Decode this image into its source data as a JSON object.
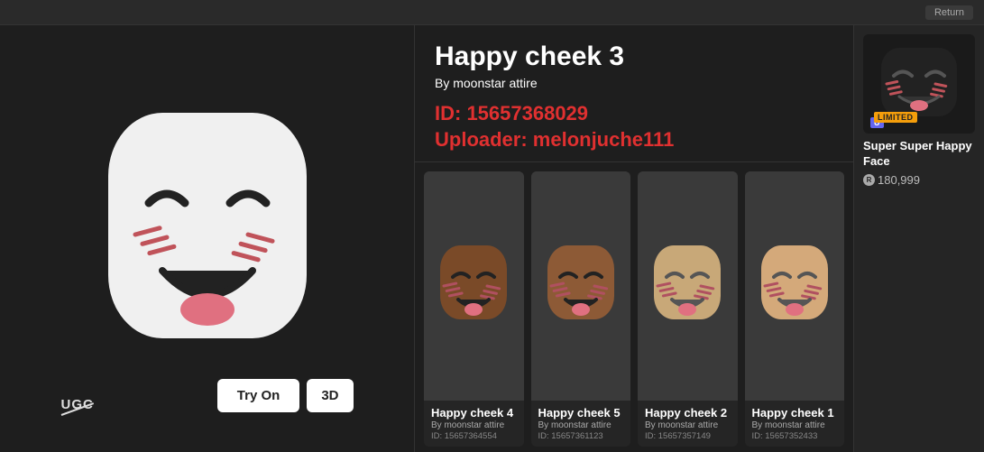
{
  "topbar": {
    "return_label": "Return"
  },
  "item": {
    "title": "Happy cheek 3",
    "creator_prefix": "By",
    "creator": "moonstar attire",
    "id_label": "ID: 15657368029",
    "uploader_label": "Uploader: melonjuche111"
  },
  "buttons": {
    "try_on": "Try On",
    "three_d": "3D"
  },
  "ugc": {
    "label": "UGC"
  },
  "featured": {
    "name": "Super Super Happy Face",
    "limited_label": "LIMITED",
    "limited_u_label": "U",
    "price": "180,999"
  },
  "related_items": [
    {
      "name": "Happy cheek 4",
      "creator": "By moonstar attire",
      "id": "ID: 15657364554",
      "skin": "dark-brown"
    },
    {
      "name": "Happy cheek 5",
      "creator": "By moonstar attire",
      "id": "ID: 15657361123",
      "skin": "brown"
    },
    {
      "name": "Happy cheek 2",
      "creator": "By moonstar attire",
      "id": "ID: 15657357149",
      "skin": "tan"
    },
    {
      "name": "Happy cheek 1",
      "creator": "By moonstar attire",
      "id": "ID: 15657352433",
      "skin": "light-tan"
    }
  ],
  "colors": {
    "accent_red": "#e03030",
    "background_dark": "#1e1e1e",
    "background_darker": "#1a1a1a",
    "panel_bg": "#2a2a2a"
  }
}
